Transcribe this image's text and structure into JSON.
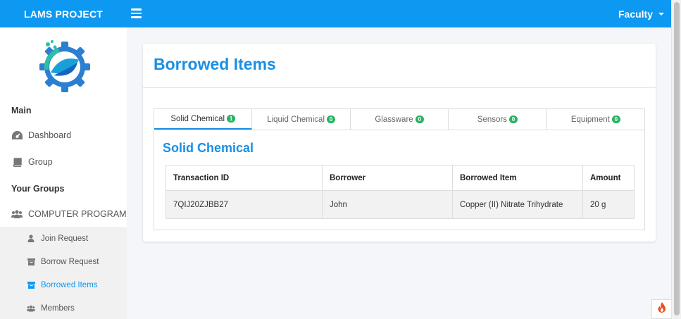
{
  "topbar": {
    "brand": "LAMS PROJECT",
    "user_label": "Faculty"
  },
  "sidebar": {
    "heading_main": "Main",
    "dashboard": "Dashboard",
    "group": "Group",
    "heading_groups": "Your Groups",
    "group_name": "COMPUTER PROGRAMMIN",
    "sub_items": [
      "Join Request",
      "Borrow Request",
      "Borrowed Items",
      "Members"
    ]
  },
  "main": {
    "title": "Borrowed Items",
    "tabs": [
      {
        "label": "Solid Chemical",
        "count": "1"
      },
      {
        "label": "Liquid Chemical",
        "count": "0"
      },
      {
        "label": "Glassware",
        "count": "0"
      },
      {
        "label": "Sensors",
        "count": "0"
      },
      {
        "label": "Equipment",
        "count": "0"
      }
    ],
    "panel_title": "Solid Chemical",
    "table": {
      "headers": [
        "Transaction ID",
        "Borrower",
        "Borrowed Item",
        "Amount"
      ],
      "rows": [
        [
          "7QIJ20ZJBB27",
          "John",
          "Copper (II) Nitrate Trihydrate",
          "20 g"
        ]
      ]
    }
  },
  "colors": {
    "primary": "#0d98f2",
    "title": "#1a8fe3",
    "badge": "#28b463"
  },
  "icons": [
    "menu-icon",
    "dashboard-icon",
    "book-icon",
    "users-icon",
    "user-icon",
    "archive-icon",
    "fire-icon"
  ]
}
